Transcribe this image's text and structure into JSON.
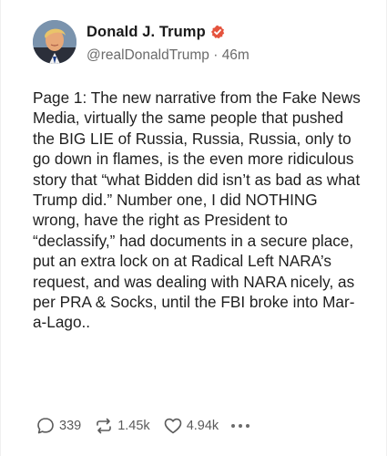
{
  "post": {
    "author_name": "Donald J. Trump",
    "handle": "@realDonaldTrump",
    "separator": " · ",
    "time_ago": "46m",
    "text": "Page 1: The new narrative from the Fake News Media, virtually the same people that pushed the BIG LIE of Russia, Russia, Russia, only to go down in flames, is the even more ridiculous story that “what Bidden did isn’t as bad as what Trump did.” Number one, I did NOTHING wrong, have the right as President to “declassify,” had documents in a secure place, put an extra lock on at Radical Left NARA’s request, and was dealing with NARA nicely, as per PRA & Socks, until the FBI broke into Mar-a-Lago..",
    "verified_badge_color": "#e5533d"
  },
  "actions": {
    "replies": "339",
    "reposts": "1.45k",
    "likes": "4.94k"
  },
  "icons": {
    "reply": "comment-bubble-icon",
    "repost": "repost-arrows-icon",
    "like": "heart-icon",
    "more": "more-dots-icon",
    "verified": "verified-check-icon"
  }
}
